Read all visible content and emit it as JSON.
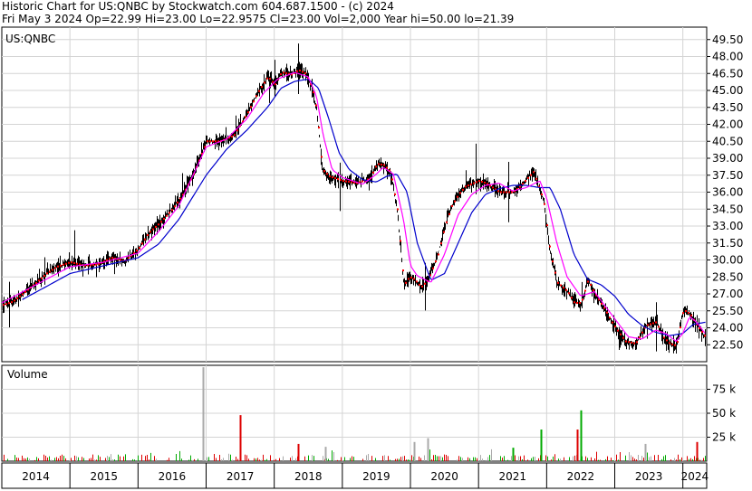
{
  "header": {
    "line1": "Historic Chart for US:QNBC by Stockwatch.com 604.687.1500 - (c) 2024",
    "line2": "Fri May  3 2024   Op=22.99  Hi=23.00  Lo=22.9575  Cl=23.00  Vol=2,000  Year hi=50.00  lo=21.39"
  },
  "chart_data": [
    {
      "type": "line",
      "symbol": "US:QNBC",
      "y_ticks": [
        "49.50",
        "48.00",
        "46.50",
        "45.00",
        "43.50",
        "42.00",
        "40.50",
        "39.00",
        "37.50",
        "36.00",
        "34.50",
        "33.00",
        "31.50",
        "30.00",
        "28.50",
        "27.00",
        "25.50",
        "24.00",
        "22.50"
      ],
      "ylim": [
        21.0,
        50.6
      ],
      "x_years": [
        "2014",
        "2015",
        "2016",
        "2017",
        "2018",
        "2019",
        "2020",
        "2021",
        "2022",
        "2023",
        "2024"
      ],
      "x_range": [
        2014.0,
        2024.35
      ],
      "grid": true,
      "colors": {
        "price": "#000000",
        "close_marks": "#ff0000",
        "ma_short": "#ff00ff",
        "ma_long": "#0000cc"
      },
      "series": [
        {
          "role": "price",
          "x": [
            2014.0,
            2014.15,
            2014.3,
            2014.5,
            2014.65,
            2014.8,
            2015.0,
            2015.2,
            2015.4,
            2015.6,
            2015.8,
            2016.0,
            2016.15,
            2016.3,
            2016.5,
            2016.65,
            2016.8,
            2017.0,
            2017.2,
            2017.4,
            2017.6,
            2017.75,
            2017.9,
            2018.0,
            2018.1,
            2018.25,
            2018.35,
            2018.45,
            2018.55,
            2018.62,
            2018.7,
            2018.8,
            2019.0,
            2019.2,
            2019.4,
            2019.5,
            2019.6,
            2019.7,
            2019.8,
            2019.85,
            2019.9,
            2019.98,
            2020.05,
            2020.15,
            2020.25,
            2020.4,
            2020.5,
            2020.6,
            2020.7,
            2020.8,
            2021.0,
            2021.1,
            2021.2,
            2021.3,
            2021.5,
            2021.6,
            2021.8,
            2021.95,
            2022.05,
            2022.15,
            2022.3,
            2022.4,
            2022.5,
            2022.6,
            2022.7,
            2022.85,
            2022.95,
            2023.05,
            2023.15,
            2023.3,
            2023.45,
            2023.6,
            2023.7,
            2023.8,
            2023.9,
            2024.0,
            2024.1,
            2024.2,
            2024.3,
            2024.34
          ],
          "values": [
            26.0,
            26.3,
            27.0,
            28.0,
            28.8,
            29.4,
            29.8,
            29.5,
            29.6,
            30.2,
            29.9,
            31.0,
            32.4,
            33.2,
            34.5,
            35.8,
            37.5,
            40.5,
            40.5,
            41.0,
            43.0,
            44.8,
            46.2,
            45.5,
            46.6,
            46.4,
            46.8,
            46.5,
            45.2,
            43.2,
            38.0,
            37.4,
            37.0,
            36.8,
            37.2,
            38.5,
            38.4,
            37.8,
            34.5,
            31.0,
            27.8,
            28.5,
            28.3,
            27.6,
            28.2,
            30.5,
            33.0,
            34.8,
            35.8,
            36.5,
            37.0,
            36.8,
            36.4,
            36.0,
            36.0,
            36.5,
            37.8,
            35.2,
            30.5,
            28.0,
            27.2,
            26.2,
            26.2,
            28.2,
            27.0,
            25.6,
            24.5,
            23.6,
            22.8,
            22.6,
            24.2,
            24.5,
            23.2,
            22.6,
            22.4,
            25.6,
            25.2,
            24.2,
            23.4,
            23.0
          ]
        },
        {
          "role": "moving-average-short",
          "x": [
            2014.0,
            2014.5,
            2015.0,
            2015.5,
            2016.0,
            2016.3,
            2016.6,
            2017.0,
            2017.3,
            2017.6,
            2017.85,
            2018.05,
            2018.3,
            2018.5,
            2018.62,
            2018.72,
            2018.85,
            2019.0,
            2019.3,
            2019.5,
            2019.6,
            2019.75,
            2019.9,
            2020.0,
            2020.1,
            2020.3,
            2020.5,
            2020.7,
            2020.9,
            2021.1,
            2021.3,
            2021.5,
            2021.7,
            2021.9,
            2022.0,
            2022.15,
            2022.3,
            2022.5,
            2022.7,
            2022.85,
            2023.0,
            2023.2,
            2023.4,
            2023.6,
            2023.75,
            2023.9,
            2024.0,
            2024.1,
            2024.2,
            2024.34
          ],
          "values": [
            26.2,
            27.8,
            29.4,
            29.8,
            30.6,
            32.5,
            34.8,
            40.0,
            40.7,
            42.5,
            44.8,
            46.0,
            46.6,
            46.2,
            44.5,
            41.0,
            38.0,
            37.3,
            36.7,
            37.6,
            38.2,
            37.6,
            33.5,
            29.5,
            28.6,
            28.0,
            30.5,
            34.0,
            35.8,
            36.6,
            36.8,
            36.1,
            36.4,
            37.0,
            35.5,
            31.5,
            28.5,
            26.8,
            27.2,
            26.0,
            24.8,
            23.2,
            23.0,
            23.8,
            23.5,
            22.8,
            23.5,
            25.0,
            24.5,
            23.4
          ]
        },
        {
          "role": "moving-average-long",
          "x": [
            2014.3,
            2014.7,
            2015.0,
            2015.5,
            2016.0,
            2016.3,
            2016.6,
            2017.0,
            2017.3,
            2017.6,
            2017.9,
            2018.1,
            2018.3,
            2018.5,
            2018.65,
            2018.8,
            2018.95,
            2019.1,
            2019.3,
            2019.5,
            2019.65,
            2019.8,
            2019.95,
            2020.1,
            2020.3,
            2020.5,
            2020.7,
            2020.9,
            2021.1,
            2021.3,
            2021.5,
            2021.7,
            2021.9,
            2022.05,
            2022.2,
            2022.4,
            2022.6,
            2022.8,
            2023.0,
            2023.2,
            2023.4,
            2023.6,
            2023.8,
            2024.0,
            2024.15,
            2024.34
          ],
          "values": [
            26.5,
            27.8,
            28.8,
            29.5,
            30.2,
            31.4,
            33.6,
            37.5,
            39.8,
            41.5,
            43.5,
            45.2,
            45.8,
            46.0,
            45.2,
            42.5,
            39.5,
            38.0,
            37.1,
            36.9,
            37.4,
            37.6,
            36.0,
            31.5,
            28.2,
            28.8,
            31.5,
            34.2,
            35.8,
            36.3,
            36.6,
            36.6,
            36.4,
            36.4,
            34.5,
            30.5,
            28.3,
            27.8,
            26.8,
            25.2,
            24.2,
            23.6,
            23.3,
            23.5,
            24.3,
            24.5
          ]
        }
      ]
    },
    {
      "type": "bar",
      "title": "Volume",
      "y_ticks": [
        "75 k",
        "50 k",
        "25 k"
      ],
      "ylim": [
        0,
        100
      ],
      "unit": "k",
      "x_range": [
        2014.0,
        2024.35
      ],
      "colors": {
        "up": "#00aa00",
        "down": "#dd0000",
        "neutral": "#aaaaaa"
      },
      "spikes": [
        {
          "x": 2016.95,
          "value": 98,
          "color": "neutral"
        },
        {
          "x": 2017.5,
          "value": 48,
          "color": "down"
        },
        {
          "x": 2018.35,
          "value": 18,
          "color": "down"
        },
        {
          "x": 2018.75,
          "value": 15,
          "color": "neutral"
        },
        {
          "x": 2020.05,
          "value": 20,
          "color": "neutral"
        },
        {
          "x": 2020.25,
          "value": 24,
          "color": "neutral"
        },
        {
          "x": 2021.5,
          "value": 14,
          "color": "up"
        },
        {
          "x": 2021.92,
          "value": 33,
          "color": "up"
        },
        {
          "x": 2022.45,
          "value": 33,
          "color": "down"
        },
        {
          "x": 2022.5,
          "value": 53,
          "color": "up"
        },
        {
          "x": 2023.45,
          "value": 18,
          "color": "neutral"
        },
        {
          "x": 2024.2,
          "value": 20,
          "color": "down"
        }
      ]
    }
  ]
}
